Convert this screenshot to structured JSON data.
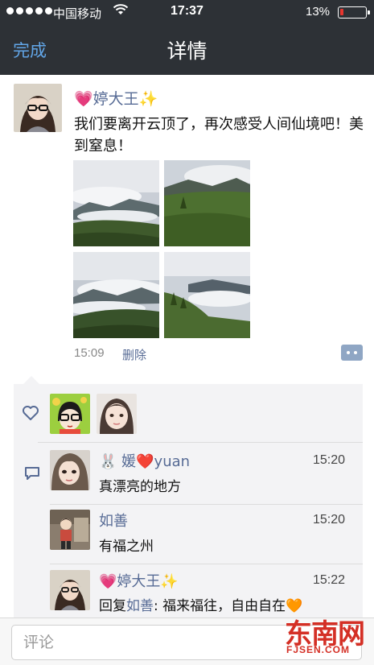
{
  "status_bar": {
    "carrier": "中国移动",
    "time": "17:37",
    "battery_percent": "13%",
    "battery_level": 0.13,
    "battery_color": "#e8362f",
    "wifi_icon": "wifi-icon"
  },
  "nav": {
    "done_label": "完成",
    "title": "详情"
  },
  "post": {
    "author": "💗婷大王✨",
    "text": "我们要离开云顶了，再次感受人间仙境吧！美到窒息！",
    "photos": [
      "photo-1",
      "photo-2",
      "photo-3",
      "photo-4"
    ],
    "time": "15:09",
    "delete_label": "删除"
  },
  "likes": {
    "icon": "heart-outline-icon"
  },
  "comments": [
    {
      "author": "🐰 媛❤️yuan",
      "time": "15:20",
      "text": "真漂亮的地方"
    },
    {
      "author": "如善",
      "time": "15:20",
      "text": "有福之州"
    },
    {
      "author": "💗婷大王✨",
      "time": "15:22",
      "reply_prefix": "回复",
      "reply_to": "如善",
      "text": ": 福来福往，自由自在🧡"
    }
  ],
  "comment_input": {
    "placeholder": "评论"
  },
  "watermark": {
    "main": "东南网",
    "sub": "FJSEN.COM"
  },
  "colors": {
    "nav_background": "#2d3136",
    "link_blue": "#576b95",
    "accent_blue": "#62a6e8",
    "watermark_red": "#d42f25"
  }
}
